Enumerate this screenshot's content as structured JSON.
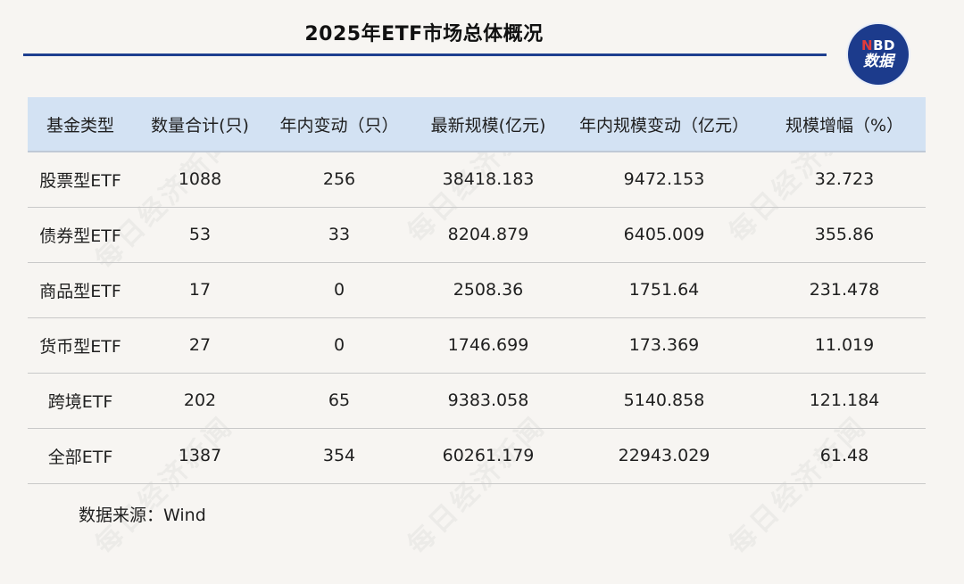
{
  "title": "2025年ETF市场总体概况",
  "logo": {
    "n": "N",
    "bd": "BD",
    "text": "数据"
  },
  "watermark": "每日经济新闻",
  "table": {
    "headers": [
      "基金类型",
      "数量合计(只)",
      "年内变动（只）",
      "最新规模(亿元)",
      "年内规模变动（亿元）",
      "规模增幅（%）"
    ],
    "rows": [
      [
        "股票型ETF",
        "1088",
        "256",
        "38418.183",
        "9472.153",
        "32.723"
      ],
      [
        "债券型ETF",
        "53",
        "33",
        "8204.879",
        "6405.009",
        "355.86"
      ],
      [
        "商品型ETF",
        "17",
        "0",
        "2508.36",
        "1751.64",
        "231.478"
      ],
      [
        "货币型ETF",
        "27",
        "0",
        "1746.699",
        "173.369",
        "11.019"
      ],
      [
        "跨境ETF",
        "202",
        "65",
        "9383.058",
        "5140.858",
        "121.184"
      ],
      [
        "全部ETF",
        "1387",
        "354",
        "60261.179",
        "22943.029",
        "61.48"
      ]
    ]
  },
  "source": "数据来源：Wind",
  "colors": {
    "accent": "#1e3f8f",
    "header_bg": "#d3e2f3",
    "page_bg": "#f7f5f2"
  }
}
